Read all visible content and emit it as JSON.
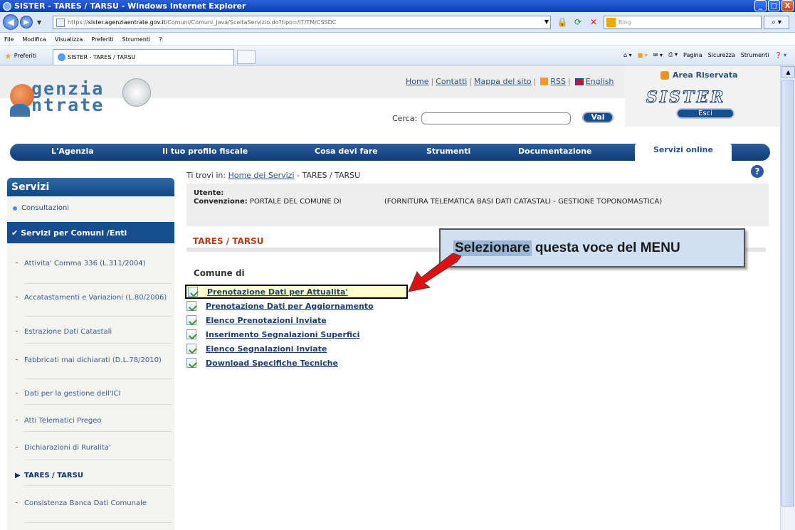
{
  "window": {
    "title": "SISTER - TARES / TARSU - Windows Internet Explorer",
    "buttons": [
      "_",
      "□",
      "X"
    ]
  },
  "address": {
    "url_prefix": "https://",
    "url_host": "sister.agenziaentrate.gov.it",
    "url_path": "/Comuni/Comuni_Java/SceltaServizio.do?tipo=/IT/TM/CSSDC",
    "search_placeholder": "Bing"
  },
  "menubar": [
    "File",
    "Modifica",
    "Visualizza",
    "Preferiti",
    "Strumenti",
    "?"
  ],
  "favorites": {
    "label": "Preferiti",
    "tab_title": "SISTER - TARES / TARSU",
    "commands": [
      "Pagina",
      "Sicurezza",
      "Strumenti"
    ]
  },
  "header": {
    "logo_line1": "genzia",
    "logo_line2": "ntrate",
    "toplinks": [
      "Home",
      "Contatti",
      "Mappa del sito",
      "RSS",
      "English"
    ],
    "search_label": "Cerca:",
    "search_button": "Vai",
    "area_title": "Area Riservata",
    "area_brand": "SISTER",
    "logout": "Esci"
  },
  "nav": [
    "L'Agenzia",
    "Il tuo profilo fiscale",
    "Cosa devi fare",
    "Strumenti",
    "Documentazione",
    "Servizi online"
  ],
  "sidebar": {
    "title": "Servizi",
    "item_consultazioni": "Consultazioni",
    "section": "Servizi per Comuni /Enti",
    "subitems": [
      "Attivita' Comma 336 (L.311/2004)",
      "Accatastamenti e Variazioni (L.80/2006)",
      "Estrazione Dati Catastali",
      "Fabbricati mai dichiarati (D.L.78/2010)",
      "Dati per la gestione dell'ICI",
      "Atti Telematici Pregeo",
      "Dichiarazioni di Ruralita'",
      "TARES / TARSU",
      "Consistenza Banca Dati Comunale"
    ]
  },
  "main": {
    "breadcrumb_prefix": "Ti trovi in:",
    "breadcrumb_link": "Home dei Servizi",
    "breadcrumb_current": "- TARES / TARSU",
    "user_label": "Utente:",
    "convention_label": "Convenzione:",
    "convention_text": "PORTALE DEL COMUNE DI",
    "convention_detail": "(FORNITURA TELEMATICA BASI DATI CATASTALI - GESTIONE TOPONOMASTICA)",
    "section_title": "TARES / TARSU",
    "comune_label": "Comune di",
    "links": [
      "Prenotazione Dati per Attualita'",
      "Prenotazione Dati per Aggiornamento",
      "Elenco Prenotazioni Inviate",
      "Inserimento Segnalazioni Superfici",
      "Elenco Segnalazioni Inviate",
      "Download Specifiche Tecniche"
    ]
  },
  "callout": {
    "highlight": "Selezionare",
    "text": "questa  voce del MENU"
  },
  "colors": {
    "brand_blue": "#154d8e",
    "title_red": "#b23c1c",
    "highlight_yellow": "#ffffcc",
    "arrow_red": "#e01010"
  }
}
